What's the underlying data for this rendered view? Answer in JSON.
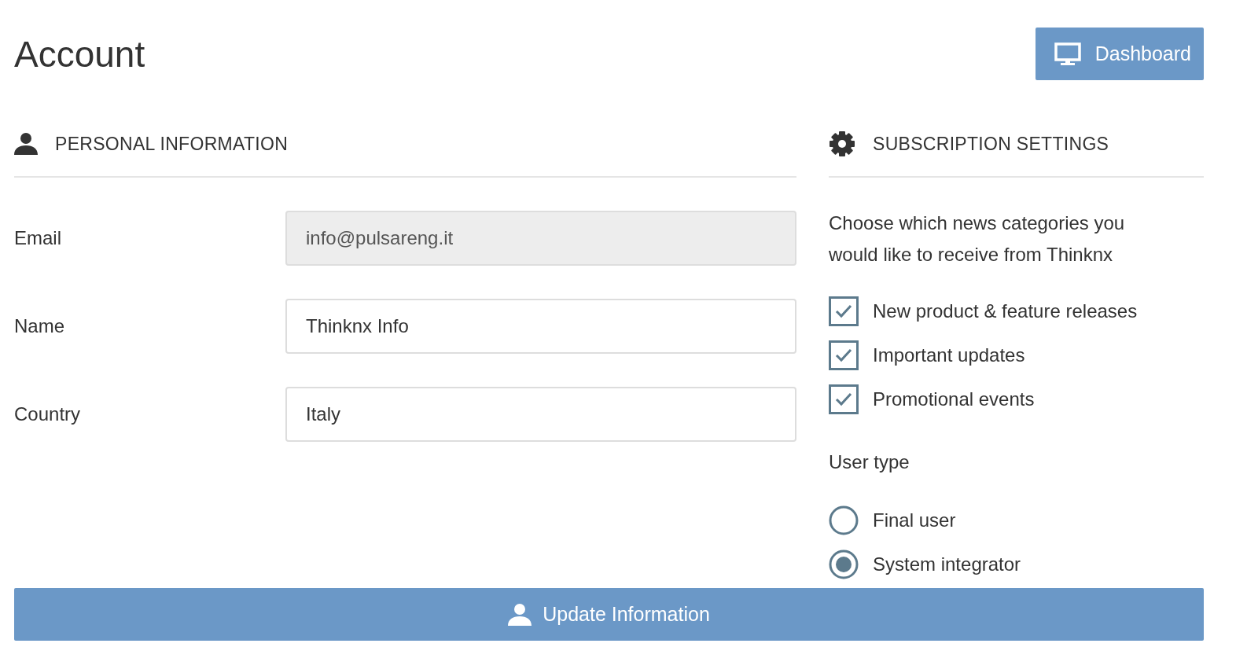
{
  "page": {
    "title": "Account"
  },
  "dashboard_button": {
    "label": "Dashboard"
  },
  "personal_information": {
    "heading": "PERSONAL INFORMATION",
    "fields": [
      {
        "label": "Email",
        "value": "info@pulsareng.it",
        "disabled": true
      },
      {
        "label": "Name",
        "value": "Thinknx Info",
        "disabled": false
      },
      {
        "label": "Country",
        "value": "Italy",
        "disabled": false
      }
    ]
  },
  "subscription_settings": {
    "heading": "SUBSCRIPTION SETTINGS",
    "description": "Choose which news categories you would like to receive from Thinknx",
    "categories": [
      {
        "label": "New product & feature releases",
        "checked": true
      },
      {
        "label": "Important updates",
        "checked": true
      },
      {
        "label": "Promotional events",
        "checked": true
      }
    ],
    "user_type_label": "User type",
    "user_types": [
      {
        "label": "Final user",
        "selected": false
      },
      {
        "label": "System integrator",
        "selected": true
      }
    ]
  },
  "update_button": {
    "label": "Update Information"
  }
}
